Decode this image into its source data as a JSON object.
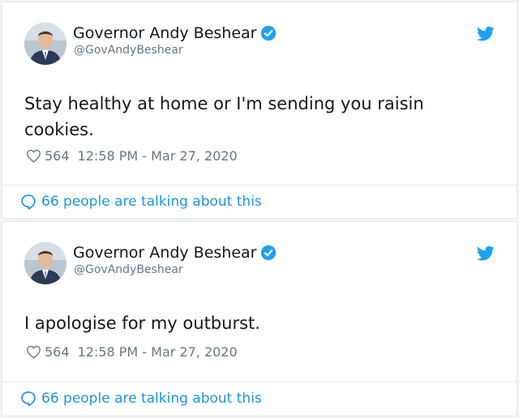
{
  "colors": {
    "link": "#1b95e0",
    "verified": "#1da1f2",
    "muted": "#657786",
    "text": "#14171a"
  },
  "tweets": [
    {
      "author_name": "Governor Andy Beshear",
      "handle": "@GovAndyBeshear",
      "verified_icon": "verified-badge-icon",
      "brand_icon": "twitter-bird-icon",
      "text": "Stay healthy at home or I'm sending you raisin cookies.",
      "likes": "564",
      "timestamp": "12:58 PM - Mar 27, 2020",
      "talking": "66 people are talking about this"
    },
    {
      "author_name": "Governor Andy Beshear",
      "handle": "@GovAndyBeshear",
      "verified_icon": "verified-badge-icon",
      "brand_icon": "twitter-bird-icon",
      "text": "I apologise for my outburst.",
      "likes": "564",
      "timestamp": "12:58 PM - Mar 27, 2020",
      "talking": "66 people are talking about this"
    }
  ]
}
